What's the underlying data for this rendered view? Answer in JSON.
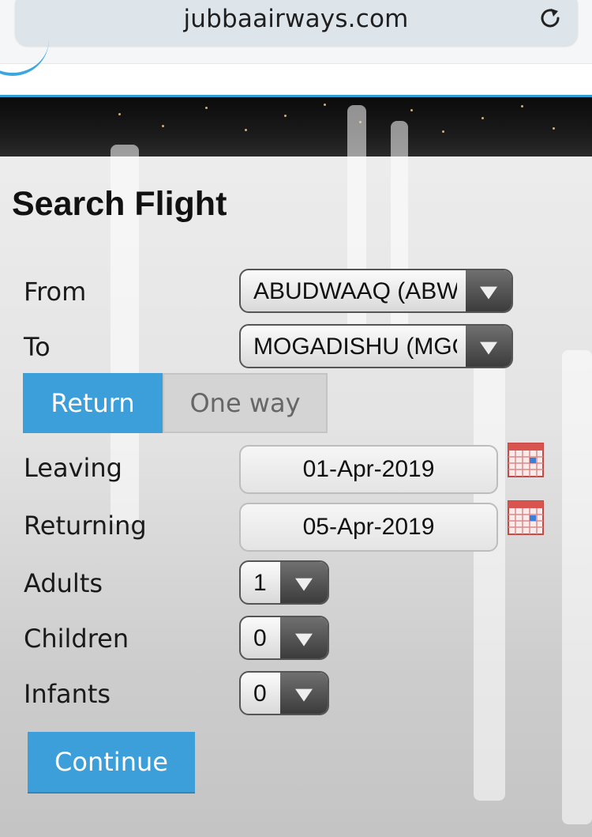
{
  "browser": {
    "url": "jubbaairways.com"
  },
  "form": {
    "title": "Search Flight",
    "from": {
      "label": "From",
      "value": "ABUDWAAQ (ABW)"
    },
    "to": {
      "label": "To",
      "value": "MOGADISHU (MGQ)"
    },
    "trip_type": {
      "return_label": "Return",
      "oneway_label": "One way",
      "selected": "Return"
    },
    "leaving": {
      "label": "Leaving",
      "value": "01-Apr-2019"
    },
    "returning": {
      "label": "Returning",
      "value": "05-Apr-2019"
    },
    "adults": {
      "label": "Adults",
      "value": "1"
    },
    "children": {
      "label": "Children",
      "value": "0"
    },
    "infants": {
      "label": "Infants",
      "value": "0"
    },
    "continue_label": "Continue"
  },
  "colors": {
    "accent": "#3c9fd9",
    "calendar_icon": "#d9534f"
  }
}
